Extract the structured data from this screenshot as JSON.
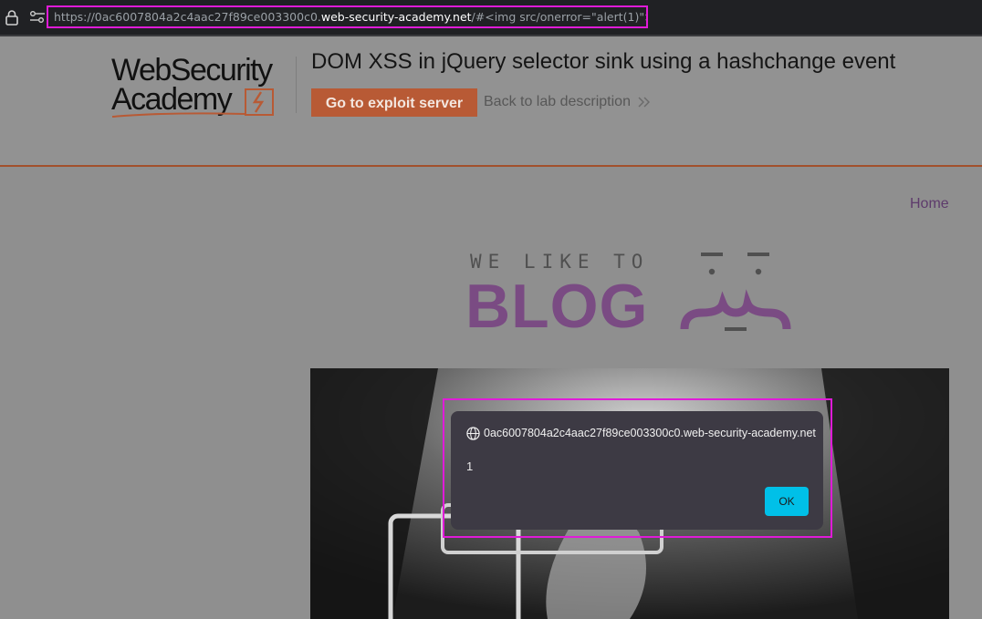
{
  "browser": {
    "url_prefix": "https://0ac6007804a2c4aac27f89ce003300c0.",
    "url_host": "web-security-academy.net",
    "url_suffix": "/#<img src/onerror=\"alert(1)\">"
  },
  "header": {
    "logo_line1": "WebSecurity",
    "logo_line2": "Academy",
    "lab_title": "DOM XSS in jQuery selector sink using a hashchange event",
    "exploit_button": "Go to exploit server",
    "back_link": "Back to lab description"
  },
  "nav": {
    "home": "Home"
  },
  "blog": {
    "tagline": "WE LIKE TO",
    "word": "BLOG"
  },
  "dialog": {
    "origin": "0ac6007804a2c4aac27f89ce003300c0.web-security-academy.net",
    "message": "1",
    "ok_label": "OK"
  },
  "colors": {
    "accent_orange": "#b85a35",
    "blog_purple": "#7a4b83",
    "highlight_magenta": "#e01bd8",
    "ok_cyan": "#00c0e8"
  }
}
